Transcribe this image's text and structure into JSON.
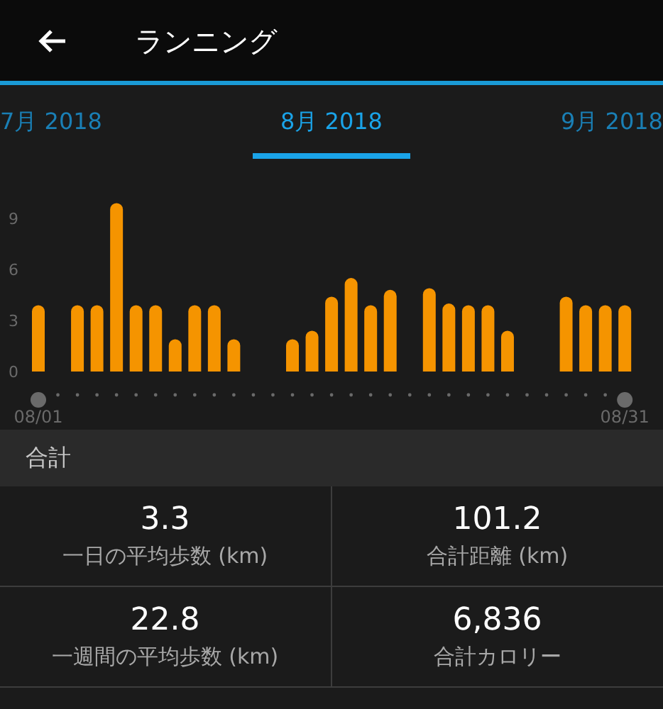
{
  "header": {
    "title": "ランニング"
  },
  "tabs": [
    {
      "label": "7月 2018",
      "selected": false
    },
    {
      "label": "8月 2018",
      "selected": true
    },
    {
      "label": "9月 2018",
      "selected": false
    }
  ],
  "chart_data": {
    "type": "bar",
    "categories": [
      "08/01",
      null,
      null,
      null,
      null,
      null,
      null,
      null,
      null,
      null,
      null,
      null,
      null,
      null,
      null,
      null,
      null,
      null,
      null,
      null,
      null,
      null,
      null,
      null,
      null,
      null,
      null,
      null,
      null,
      null,
      "08/31"
    ],
    "series": [
      {
        "color": "#f59400",
        "values": [
          3.9,
          null,
          3.9,
          3.9,
          9.9,
          3.9,
          3.9,
          1.9,
          3.9,
          3.9,
          1.9,
          null,
          null,
          1.9,
          2.4,
          4.4,
          5.5,
          3.9,
          4.8,
          null,
          4.9,
          4.0,
          3.9,
          3.9,
          2.4,
          null,
          null,
          4.4,
          3.9,
          3.9,
          3.9
        ]
      }
    ],
    "ylim": [
      0,
      10
    ],
    "yticks": [
      0,
      3,
      6,
      9
    ]
  },
  "summary": {
    "title": "合計",
    "stats": [
      {
        "value": "3.3",
        "label": "一日の平均歩数 (km)"
      },
      {
        "value": "101.2",
        "label": "合計距離 (km)"
      },
      {
        "value": "22.8",
        "label": "一週間の平均歩数 (km)"
      },
      {
        "value": "6,836",
        "label": "合計カロリー"
      }
    ]
  }
}
